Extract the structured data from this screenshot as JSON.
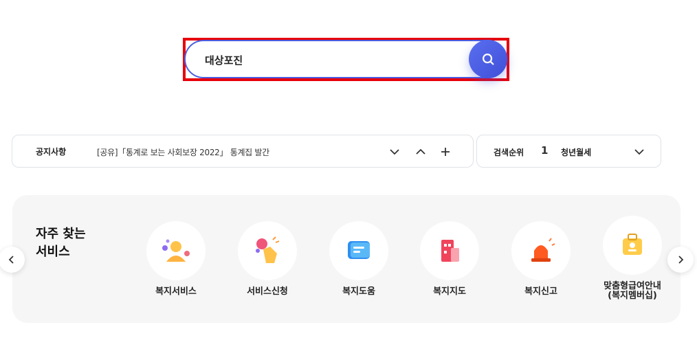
{
  "search": {
    "value": "대상포진"
  },
  "notice": {
    "label": "공지사항",
    "text": "[공유]「통계로 보는 사회보장 2022」 통계집 발간"
  },
  "ranking": {
    "label": "검색순위",
    "rank": "1",
    "term": "청년월세"
  },
  "services": {
    "title": "자주 찾는\n서비스",
    "items": [
      {
        "label": "복지서비스",
        "icon": "people-icon"
      },
      {
        "label": "서비스신청",
        "icon": "hand-pointer-icon"
      },
      {
        "label": "복지도움",
        "icon": "chat-bubble-icon"
      },
      {
        "label": "복지지도",
        "icon": "map-building-icon"
      },
      {
        "label": "복지신고",
        "icon": "alarm-siren-icon"
      },
      {
        "label": "맞춤형급여안내\n(복지멤버십)",
        "icon": "membership-badge-icon"
      }
    ]
  },
  "colors": {
    "accent": "#4b5ee0",
    "highlight": "#e8000b"
  }
}
